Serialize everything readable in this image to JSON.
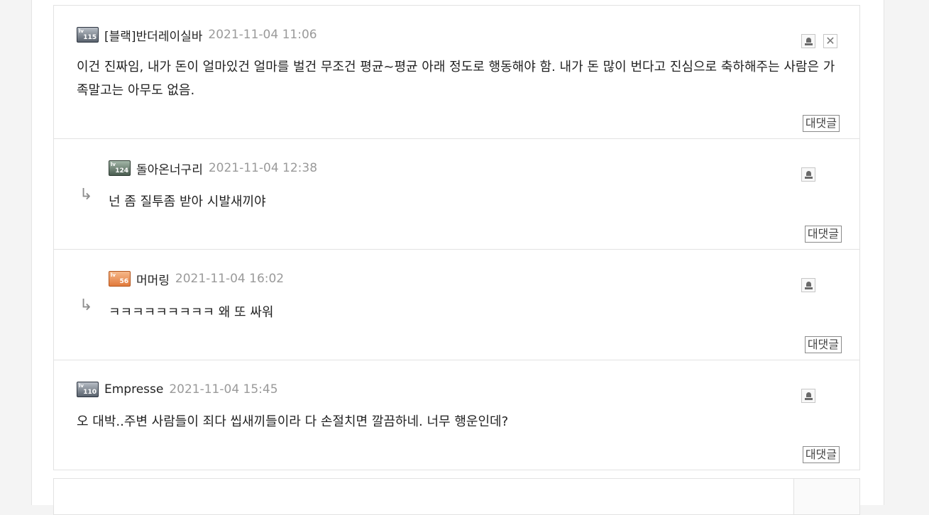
{
  "comments": [
    {
      "level": "115",
      "author": "[블랙]반더레이실바",
      "date": "2021-11-04 11:06",
      "body": "이건 진짜임, 내가 돈이 얼마있건 얼마를 벌건 무조건 평균~평균 아래 정도로 행동해야 함. 내가 돈 많이 번다고 진심으로 축하해주는 사람은 가족말고는 아무도 없음.",
      "reply_label": "대댓글"
    },
    {
      "level": "124",
      "author": "돌아온너구리",
      "date": "2021-11-04 12:38",
      "body": "넌 좀 질투좀 받아 시발새끼야",
      "reply_label": "대댓글",
      "arrow": "↳"
    },
    {
      "level": "56",
      "author": "머머링",
      "date": "2021-11-04 16:02",
      "body": "ㅋㅋㅋㅋㅋㅋㅋㅋㅋ 왜 또 싸워",
      "reply_label": "대댓글",
      "arrow": "↳"
    },
    {
      "level": "110",
      "author": "Empresse",
      "date": "2021-11-04 15:45",
      "body": "오 대박..주변 사람들이 죄다 씹새끼들이라 다 손절치면 깔끔하네. 너무 행운인데?",
      "reply_label": "대댓글"
    }
  ],
  "icons": {
    "report": "report-icon",
    "delete": "close-icon",
    "reply_arrow": "reply-arrow-icon"
  }
}
